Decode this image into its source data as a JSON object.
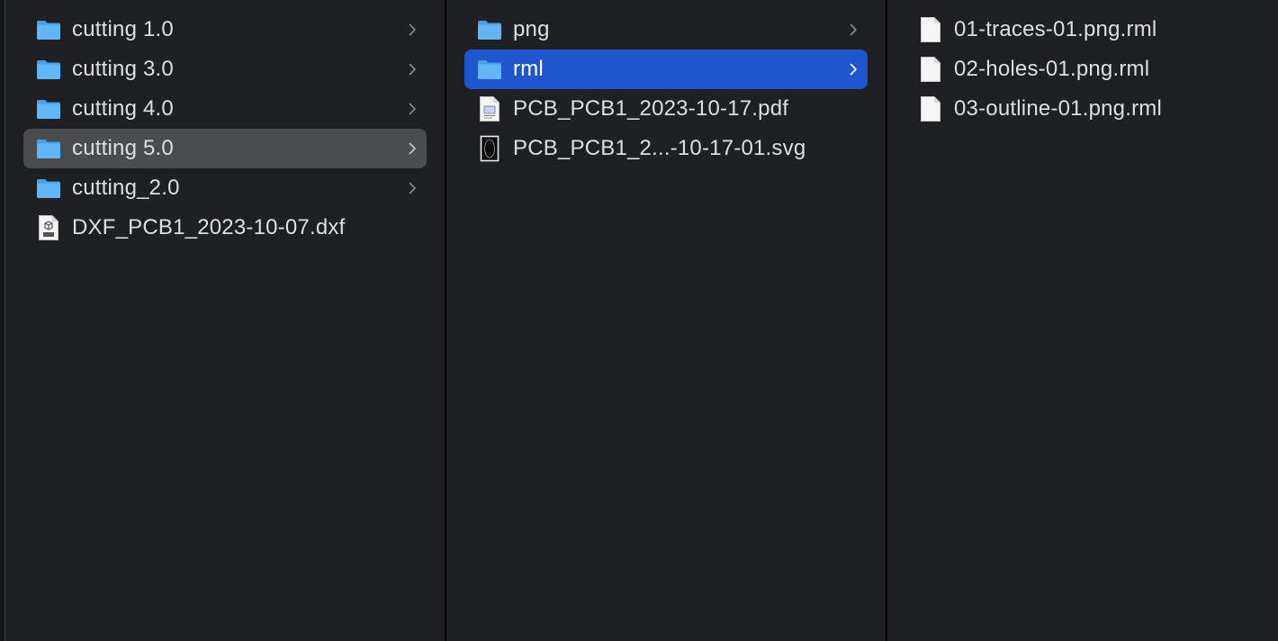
{
  "colors": {
    "background": "#1e2023",
    "selected_active": "#1f56ce",
    "selected_inactive": "#4b4c4e",
    "folder": "#62b6f5",
    "text": "#dfdfe0"
  },
  "columns": [
    {
      "items": [
        {
          "name": "cutting 1.0",
          "icon": "folder-icon",
          "has_children": true
        },
        {
          "name": "cutting 3.0",
          "icon": "folder-icon",
          "has_children": true
        },
        {
          "name": "cutting 4.0",
          "icon": "folder-icon",
          "has_children": true
        },
        {
          "name": "cutting 5.0",
          "icon": "folder-icon",
          "has_children": true,
          "selected": "inactive"
        },
        {
          "name": "cutting_2.0",
          "icon": "folder-icon",
          "has_children": true
        },
        {
          "name": "DXF_PCB1_2023-10-07.dxf",
          "icon": "dxf-file-icon",
          "has_children": false
        }
      ]
    },
    {
      "items": [
        {
          "name": "png",
          "icon": "folder-icon",
          "has_children": true
        },
        {
          "name": "rml",
          "icon": "folder-icon",
          "has_children": true,
          "selected": "active"
        },
        {
          "name": "PCB_PCB1_2023-10-17.pdf",
          "icon": "pdf-file-icon",
          "has_children": false
        },
        {
          "name": "PCB_PCB1_2...-10-17-01.svg",
          "icon": "svg-file-icon",
          "has_children": false
        }
      ]
    },
    {
      "items": [
        {
          "name": "01-traces-01.png.rml",
          "icon": "document-icon",
          "has_children": false
        },
        {
          "name": "02-holes-01.png.rml",
          "icon": "document-icon",
          "has_children": false
        },
        {
          "name": "03-outline-01.png.rml",
          "icon": "document-icon",
          "has_children": false
        }
      ]
    }
  ]
}
